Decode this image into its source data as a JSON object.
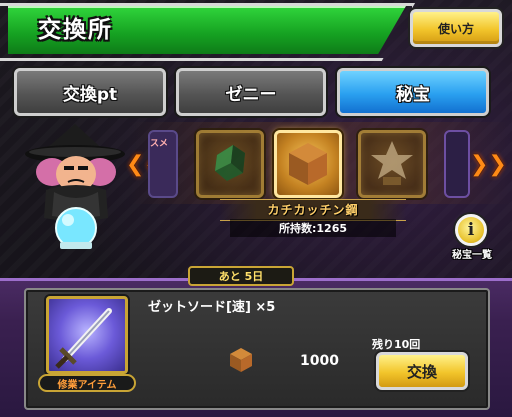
{
  "header": {
    "title": "交換所",
    "guide_button": "使い方"
  },
  "tabs": [
    {
      "label": "交換pt",
      "active": false
    },
    {
      "label": "ゼニー",
      "active": false
    },
    {
      "label": "秘宝",
      "active": true
    }
  ],
  "carousel": {
    "partial_left_label": "スメ",
    "items": [
      {
        "icon": "partial-item-icon"
      },
      {
        "icon": "green-crystal-icon"
      },
      {
        "icon": "katchin-cube-icon",
        "selected": true
      },
      {
        "icon": "shenron-trophy-icon"
      },
      {
        "icon": "partial-item-icon"
      }
    ]
  },
  "selected_item": {
    "name": "カチカッチン鋼",
    "owned": "所持数:1265"
  },
  "treasure_list_button": {
    "icon": "info-icon",
    "label": "秘宝一覧",
    "glyph": "i"
  },
  "offer": {
    "deadline": "あと 5日",
    "reward_name": "ゼットソード[速] ×5",
    "reward_tag": "修業アイテム",
    "remaining": "残り10回",
    "cost": "1000",
    "exchange_button": "交換"
  },
  "colors": {
    "header_green": "#16a322",
    "active_tab_blue": "#2aa0f0",
    "button_gold": "#f2c52b",
    "panel_purple": "#3a2050",
    "accent_orange": "#ff8a16"
  }
}
